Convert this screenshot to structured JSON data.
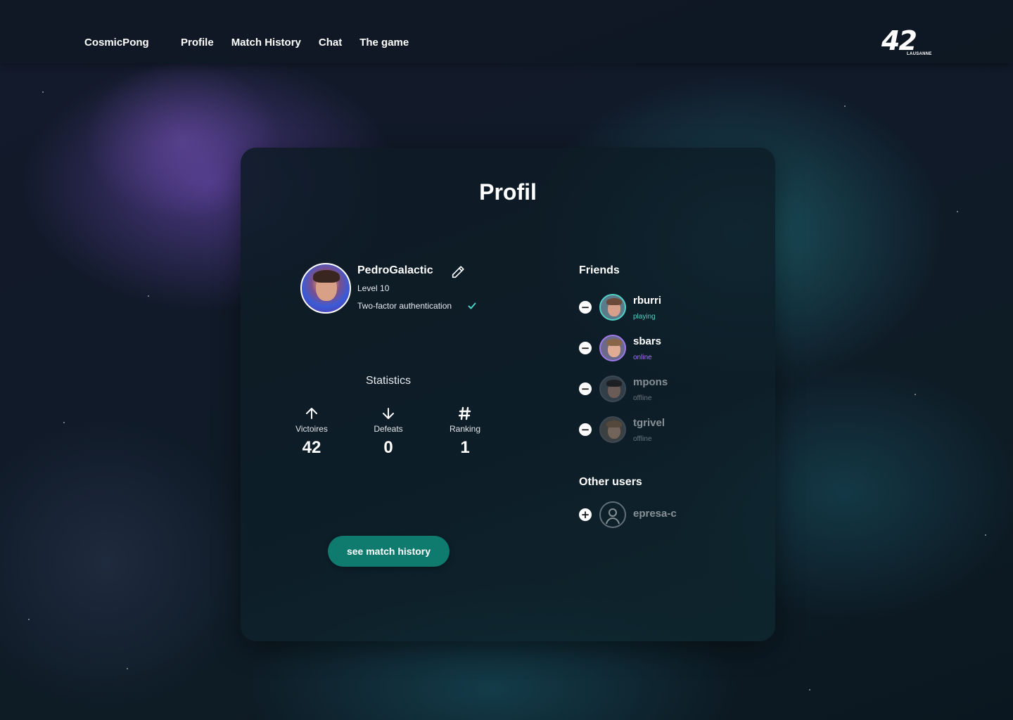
{
  "nav": {
    "brand": "CosmicPong",
    "links": [
      "Profile",
      "Match History",
      "Chat",
      "The game"
    ],
    "logo_number": "42",
    "logo_sub": "LAUSANNE"
  },
  "profile": {
    "title": "Profil",
    "username": "PedroGalactic",
    "level": "Level 10",
    "two_factor": "Two-factor authentication",
    "stats_title": "Statistics",
    "stats": [
      {
        "label": "Victoires",
        "value": "42",
        "icon": "arrow-up-icon"
      },
      {
        "label": "Defeats",
        "value": "0",
        "icon": "arrow-down-icon"
      },
      {
        "label": "Ranking",
        "value": "1",
        "icon": "hash-icon"
      }
    ],
    "history_button": "see match history"
  },
  "friends": {
    "title": "Friends",
    "items": [
      {
        "name": "rburri",
        "status": "playing",
        "status_color": "#4fd1c5"
      },
      {
        "name": "sbars",
        "status": "online",
        "status_color": "#9f7aea"
      },
      {
        "name": "mpons",
        "status": "offline",
        "status_color": "#9aa3ad"
      },
      {
        "name": "tgrivel",
        "status": "offline",
        "status_color": "#9aa3ad"
      }
    ]
  },
  "other_users": {
    "title": "Other users",
    "items": [
      {
        "name": "epresa-c"
      }
    ]
  },
  "colors": {
    "accent_button": "#0f7a6e",
    "ring_playing": "#4fd1c5",
    "ring_online": "#9f7aea"
  }
}
